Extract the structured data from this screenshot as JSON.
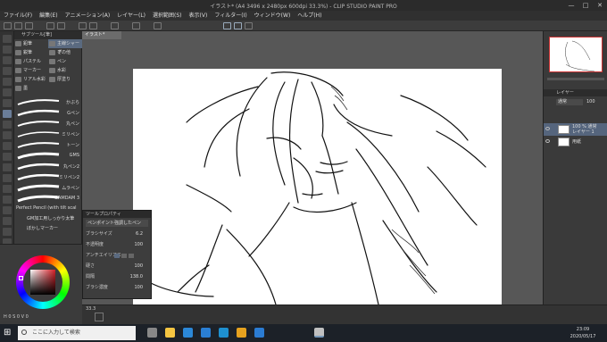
{
  "window": {
    "title": "イラスト* (A4 3496 x 2480px 600dpi 33.3%) - CLIP STUDIO PAINT PRO",
    "controls": [
      "—",
      "□",
      "✕"
    ]
  },
  "menu": {
    "items": [
      "ファイル(F)",
      "編集(E)",
      "アニメーション(A)",
      "レイヤー(L)",
      "選択範囲(S)",
      "表示(V)",
      "フィルター(I)",
      "ウィンドウ(W)",
      "ヘルプ(H)"
    ]
  },
  "subtool": {
    "header": "サブツール[筆]",
    "categories": [
      {
        "label": "鉛筆",
        "selected": false
      },
      {
        "label": "主線シャープ",
        "selected": true
      },
      {
        "label": "鋭筆",
        "selected": false
      },
      {
        "label": "その他",
        "selected": false
      },
      {
        "label": "パステル",
        "selected": false
      },
      {
        "label": "ペン",
        "selected": false
      },
      {
        "label": "マーカー",
        "selected": false
      },
      {
        "label": "水彩",
        "selected": false
      },
      {
        "label": "リアル水彩",
        "selected": false
      },
      {
        "label": "厚塗り",
        "selected": false
      },
      {
        "label": "墨",
        "selected": false
      }
    ],
    "brushes": [
      "かぶら",
      "Gペン",
      "丸ペン",
      "ミリペン",
      "トーン",
      "GMS",
      "丸ペン2",
      "ミリペン2",
      "ムラペン",
      "DAMDAM 3"
    ],
    "footer_items": [
      "Perfect Pencil (with tilt scal",
      "GM加工用しっかり太筆",
      "ぼかしマーカー"
    ]
  },
  "tool_property": {
    "header": "ツールプロパティ",
    "tool_name": "ペンポイント強調したペン",
    "rows": [
      {
        "label": "ブラシサイズ",
        "value": "6.2"
      },
      {
        "label": "不透明度",
        "value": "100"
      },
      {
        "label": "アンチエイリアス",
        "value": ""
      },
      {
        "label": "硬さ",
        "value": "100"
      },
      {
        "label": "間隔",
        "value": "138.0"
      },
      {
        "label": "ブラシ濃度",
        "value": "100"
      }
    ]
  },
  "color": {
    "fg": "#000000",
    "bg": "#ffffff",
    "hue_indicator": "#d42028",
    "bottom_text": "H 0  S 0  V 0"
  },
  "canvas": {
    "tab_label": "イラスト*",
    "zoom": "33.3",
    "paper_color": "#ffffff",
    "background": "#575757"
  },
  "layers": {
    "header": "レイヤー",
    "blend_mode": "通常",
    "opacity": "100",
    "items": [
      {
        "name": "100 % 通常\nレイヤー 1",
        "selected": true
      },
      {
        "name": "用紙",
        "selected": false
      }
    ]
  },
  "taskbar": {
    "search_placeholder": "ここに入力して検索",
    "time": "23:09",
    "date": "2020/05/17",
    "apps": [
      {
        "name": "task-view",
        "color": "#888888"
      },
      {
        "name": "explorer",
        "color": "#f4c542"
      },
      {
        "name": "store",
        "color": "#2b88d8"
      },
      {
        "name": "mail",
        "color": "#2a7fd4"
      },
      {
        "name": "edge",
        "color": "#1e90d0"
      },
      {
        "name": "chrome",
        "color": "#e6a21f"
      },
      {
        "name": "edge-legacy",
        "color": "#2b7cd3"
      },
      {
        "name": "clip-studio",
        "color": "#c0c0c0"
      }
    ]
  }
}
